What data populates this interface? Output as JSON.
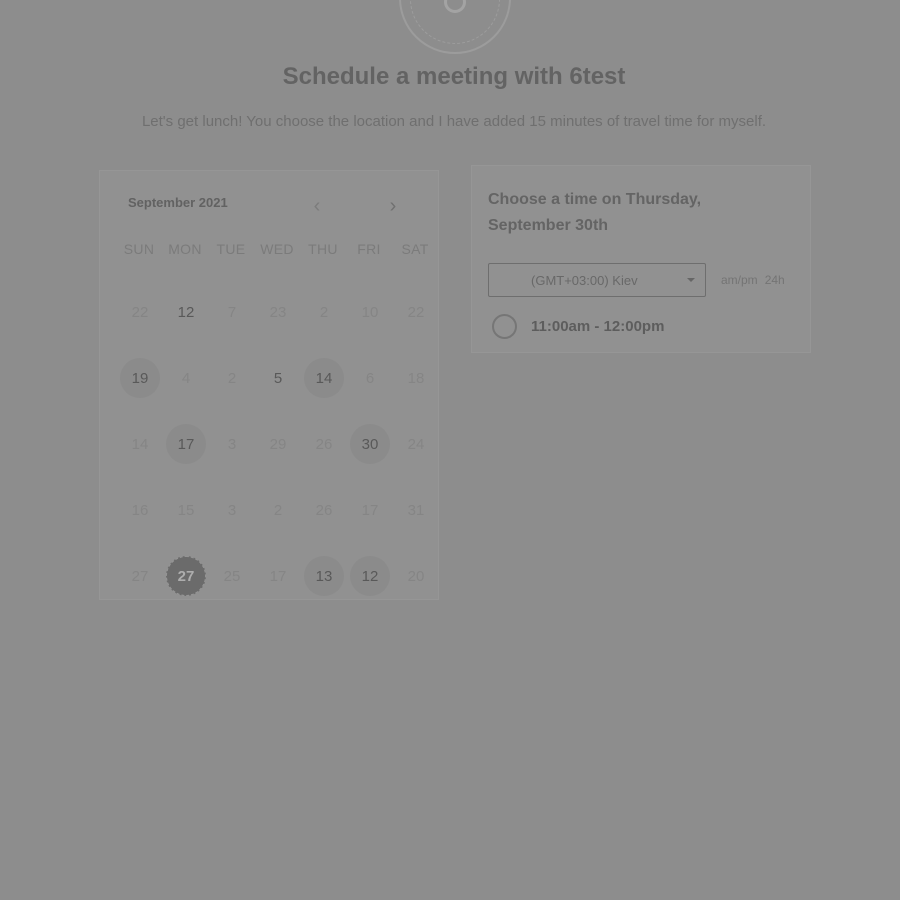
{
  "header": {
    "title": "Schedule a meeting with 6test",
    "description": "Let's get lunch! You choose the location and I have added 15 minutes of travel time for myself."
  },
  "calendar": {
    "month_label": "September 2021",
    "prev_icon": "chevron-left-icon",
    "next_icon": "chevron-right-icon",
    "weekdays": [
      "SUN",
      "MON",
      "TUE",
      "WED",
      "THU",
      "FRI",
      "SAT"
    ],
    "days": [
      {
        "label": "22",
        "state": "disabled"
      },
      {
        "label": "12",
        "state": "number-only"
      },
      {
        "label": "7",
        "state": "disabled"
      },
      {
        "label": "23",
        "state": "disabled"
      },
      {
        "label": "2",
        "state": "disabled"
      },
      {
        "label": "10",
        "state": "disabled"
      },
      {
        "label": "22",
        "state": "disabled"
      },
      {
        "label": "19",
        "state": "available"
      },
      {
        "label": "4",
        "state": "disabled"
      },
      {
        "label": "2",
        "state": "disabled"
      },
      {
        "label": "5",
        "state": "number-only"
      },
      {
        "label": "14",
        "state": "available"
      },
      {
        "label": "6",
        "state": "disabled"
      },
      {
        "label": "18",
        "state": "disabled"
      },
      {
        "label": "14",
        "state": "disabled"
      },
      {
        "label": "17",
        "state": "available"
      },
      {
        "label": "3",
        "state": "disabled"
      },
      {
        "label": "29",
        "state": "disabled"
      },
      {
        "label": "26",
        "state": "disabled"
      },
      {
        "label": "30",
        "state": "available"
      },
      {
        "label": "24",
        "state": "disabled"
      },
      {
        "label": "16",
        "state": "disabled"
      },
      {
        "label": "15",
        "state": "disabled"
      },
      {
        "label": "3",
        "state": "disabled"
      },
      {
        "label": "2",
        "state": "disabled"
      },
      {
        "label": "26",
        "state": "disabled"
      },
      {
        "label": "17",
        "state": "disabled"
      },
      {
        "label": "31",
        "state": "disabled"
      },
      {
        "label": "27",
        "state": "disabled"
      },
      {
        "label": "27",
        "state": "selected"
      },
      {
        "label": "25",
        "state": "disabled"
      },
      {
        "label": "17",
        "state": "disabled"
      },
      {
        "label": "13",
        "state": "available"
      },
      {
        "label": "12",
        "state": "available"
      },
      {
        "label": "20",
        "state": "disabled"
      }
    ]
  },
  "times": {
    "heading": "Choose a time on Thursday, September 30th",
    "timezone": "(GMT+03:00) Kiev",
    "format_12h": "am/pm",
    "format_24h": "24h",
    "slots": [
      "11:00am - 12:00pm"
    ]
  }
}
